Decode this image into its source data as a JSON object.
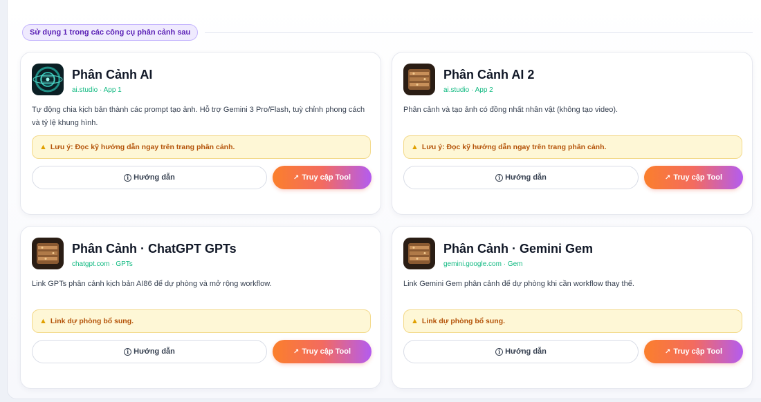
{
  "section": {
    "label": "Sử dụng 1 trong các công cụ phân cảnh sau"
  },
  "cards": [
    {
      "title": "Phân Cảnh AI",
      "subtitle": "ai.studio · App 1",
      "description": "Tự động chia kịch bản thành các prompt tạo ảnh. Hỗ trợ Gemini 3 Pro/Flash, tuỳ chỉnh phong cách và tỷ lệ khung hình.",
      "note": "Lưu ý: Đọc kỹ hướng dẫn ngay trên trang phân cảnh.",
      "guide_label": "Hướng dẫn",
      "access_label": "Truy cập Tool",
      "icon": "ai-studio-app-icon"
    },
    {
      "title": "Phân Cảnh AI 2",
      "subtitle": "ai.studio · App 2",
      "description": "Phân cảnh và tạo ảnh có đồng nhất nhân vật (không tạo video).",
      "note": "Lưu ý: Đọc kỹ hướng dẫn ngay trên trang phân cảnh.",
      "guide_label": "Hướng dẫn",
      "access_label": "Truy cập Tool",
      "icon": "film-reel-app-icon"
    },
    {
      "title": "Phân Cảnh · ChatGPT GPTs",
      "subtitle": "chatgpt.com · GPTs",
      "description": "Link GPTs phân cảnh kịch bản AI86 để dự phòng và mở rộng workflow.",
      "note": "Link dự phòng bổ sung.",
      "guide_label": "Hướng dẫn",
      "access_label": "Truy cập Tool",
      "icon": "film-reel-app-icon"
    },
    {
      "title": "Phân Cảnh · Gemini Gem",
      "subtitle": "gemini.google.com · Gem",
      "description": "Link Gemini Gem phân cảnh để dự phòng khi cần workflow thay thế.",
      "note": "Link dự phòng bổ sung.",
      "guide_label": "Hướng dẫn",
      "access_label": "Truy cập Tool",
      "icon": "film-reel-app-icon"
    }
  ],
  "colors": {
    "accent_orange": "#fb7f2c",
    "accent_purple": "#b35cf0",
    "subtitle_green": "#10b981",
    "note_bg": "#fef7d6",
    "note_text": "#b45309"
  }
}
